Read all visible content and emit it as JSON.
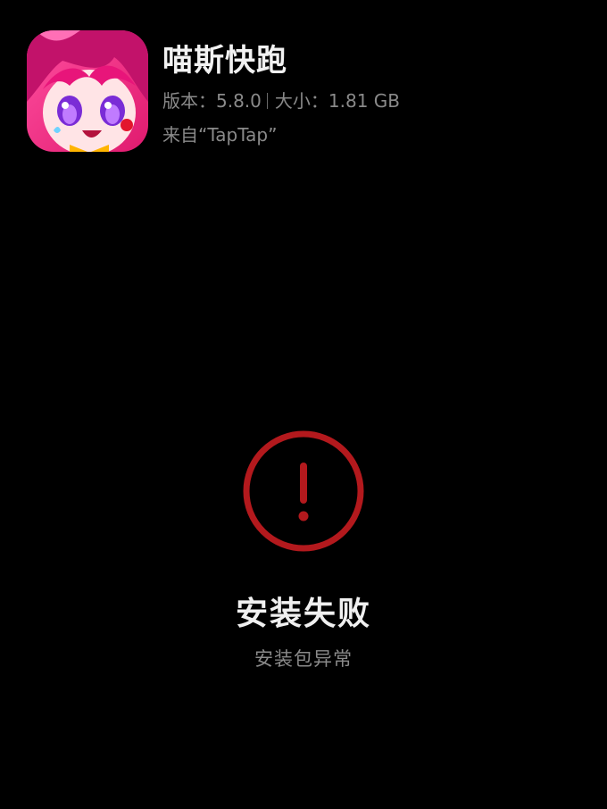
{
  "app": {
    "name": "喵斯快跑",
    "version_label": "版本：",
    "version_value": "5.8.0",
    "size_label": "大小：",
    "size_value": "1.81 GB",
    "source": "来自“TapTap”",
    "icon": "app-icon-anime-girl"
  },
  "result": {
    "icon": "error-circle-exclamation-icon",
    "title": "安装失败",
    "subtitle": "安装包异常"
  },
  "colors": {
    "background": "#000000",
    "error_red": "#b3191d",
    "primary_text": "#f0f0f0",
    "secondary_text": "#8a8a8a"
  }
}
